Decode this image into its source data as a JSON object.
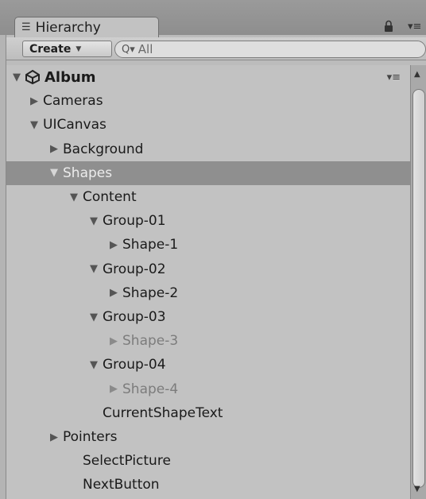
{
  "panel": {
    "tab_label": "Hierarchy",
    "tab_icon": "list-icon",
    "lock_icon": "lock-icon",
    "menu_icon": "tab-menu-icon"
  },
  "toolbar": {
    "create_label": "Create",
    "search_placeholder": "All",
    "search_prefix_icon": "search-dropdown-icon"
  },
  "scene": {
    "name": "Album",
    "icon": "unity-scene-icon",
    "expanded": true
  },
  "tree": [
    {
      "label": "Cameras",
      "depth": 1,
      "arrow": "collapsed",
      "state": "normal"
    },
    {
      "label": "UICanvas",
      "depth": 1,
      "arrow": "expanded",
      "state": "normal"
    },
    {
      "label": "Background",
      "depth": 2,
      "arrow": "collapsed",
      "state": "normal"
    },
    {
      "label": "Shapes",
      "depth": 2,
      "arrow": "expanded",
      "state": "selected"
    },
    {
      "label": "Content",
      "depth": 3,
      "arrow": "expanded",
      "state": "normal"
    },
    {
      "label": "Group-01",
      "depth": 4,
      "arrow": "expanded",
      "state": "normal"
    },
    {
      "label": "Shape-1",
      "depth": 5,
      "arrow": "collapsed",
      "state": "normal"
    },
    {
      "label": "Group-02",
      "depth": 4,
      "arrow": "expanded",
      "state": "normal"
    },
    {
      "label": "Shape-2",
      "depth": 5,
      "arrow": "collapsed",
      "state": "normal"
    },
    {
      "label": "Group-03",
      "depth": 4,
      "arrow": "expanded",
      "state": "normal"
    },
    {
      "label": "Shape-3",
      "depth": 5,
      "arrow": "collapsed",
      "state": "inactive"
    },
    {
      "label": "Group-04",
      "depth": 4,
      "arrow": "expanded",
      "state": "normal"
    },
    {
      "label": "Shape-4",
      "depth": 5,
      "arrow": "collapsed",
      "state": "inactive"
    },
    {
      "label": "CurrentShapeText",
      "depth": 4,
      "arrow": "none",
      "state": "normal"
    },
    {
      "label": "Pointers",
      "depth": 2,
      "arrow": "collapsed",
      "state": "normal"
    },
    {
      "label": "SelectPicture",
      "depth": 3,
      "arrow": "none",
      "state": "normal"
    },
    {
      "label": "NextButton",
      "depth": 3,
      "arrow": "none",
      "state": "normal"
    }
  ],
  "colors": {
    "selected_row": "#8f8f8f",
    "inactive_text": "#7c7c7c"
  }
}
